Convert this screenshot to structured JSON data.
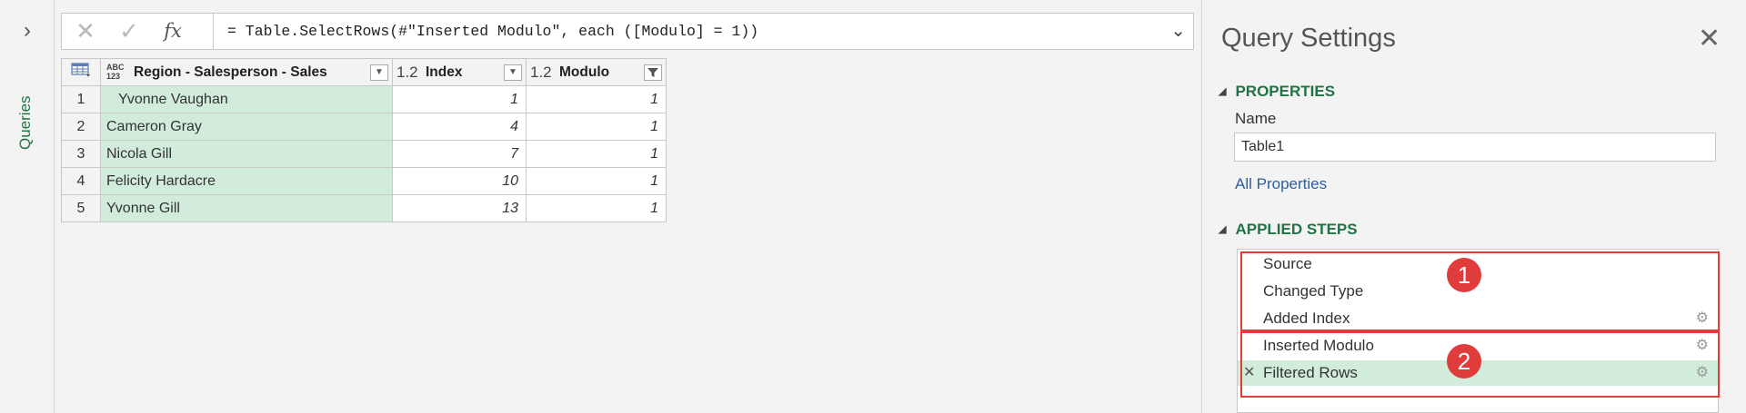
{
  "sidebar": {
    "expand_icon": "chevron-right-icon",
    "queries_label": "Queries"
  },
  "formula_bar": {
    "cancel_icon": "✕",
    "commit_icon": "✓",
    "fx_label": "fx",
    "formula": "= Table.SelectRows(#\"Inserted Modulo\", each ([Modulo] = 1))",
    "expand_icon": "⌄"
  },
  "grid": {
    "columns": [
      {
        "type": "ABC 123",
        "name": "Region - Salesperson - Sales"
      },
      {
        "type": "1.2",
        "name": "Index"
      },
      {
        "type": "1.2",
        "name": "Modulo"
      }
    ],
    "rows": [
      {
        "num": "1",
        "region": "   Yvonne Vaughan",
        "index": "1",
        "modulo": "1"
      },
      {
        "num": "2",
        "region": "Cameron Gray",
        "index": "4",
        "modulo": "1"
      },
      {
        "num": "3",
        "region": "Nicola Gill",
        "index": "7",
        "modulo": "1"
      },
      {
        "num": "4",
        "region": "Felicity Hardacre",
        "index": "10",
        "modulo": "1"
      },
      {
        "num": "5",
        "region": "Yvonne Gill",
        "index": "13",
        "modulo": "1"
      }
    ]
  },
  "query_settings": {
    "title": "Query Settings",
    "close_icon": "✕",
    "properties": {
      "heading": "PROPERTIES",
      "name_label": "Name",
      "name_value": "Table1",
      "all_properties_link": "All Properties"
    },
    "applied_steps": {
      "heading": "APPLIED STEPS",
      "steps": [
        {
          "label": "Source"
        },
        {
          "label": "Changed Type"
        },
        {
          "label": "Added Index"
        },
        {
          "label": "Inserted Modulo"
        },
        {
          "label": "Filtered Rows"
        }
      ],
      "delete_icon": "✕",
      "gear_icon": "⚙"
    },
    "annotations": {
      "badge_1": "1",
      "badge_2": "2"
    }
  },
  "colors": {
    "accent": "#217346",
    "selection": "#d2ecdc",
    "annotation": "#e03c3c",
    "link": "#2e5e9e"
  }
}
